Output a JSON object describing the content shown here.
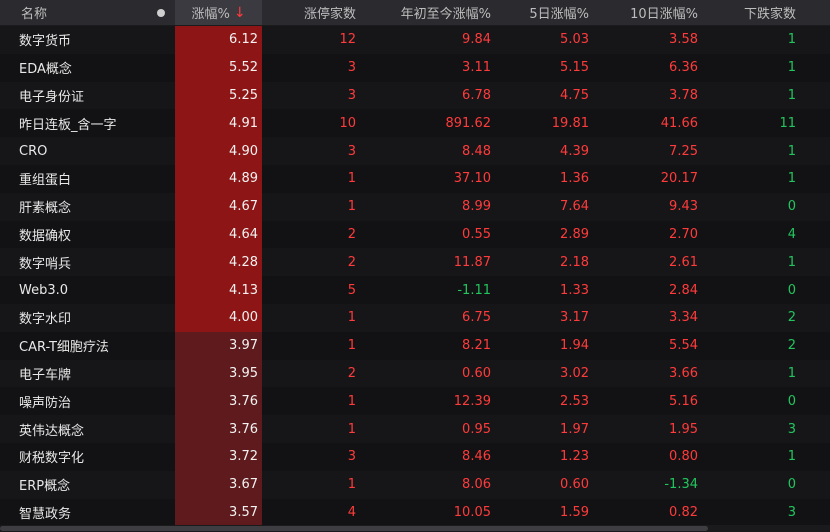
{
  "header": {
    "name": "名称",
    "change": "涨幅%",
    "sort_arrow": "↓",
    "limit_up": "涨停家数",
    "ytd": "年初至今涨幅%",
    "d5": "5日涨幅%",
    "d10": "10日涨幅%",
    "down": "下跌家数"
  },
  "colors": {
    "up": "#ff3b3b",
    "down": "#22c55e",
    "change_bg_strong": "#8e1515",
    "change_bg_weak": "#5e1a1c"
  },
  "rows": [
    {
      "name": "数字货币",
      "chg": "6.12",
      "lim": "12",
      "ytd": "9.84",
      "d5": "5.03",
      "d10": "3.58",
      "down": "1"
    },
    {
      "name": "EDA概念",
      "chg": "5.52",
      "lim": "3",
      "ytd": "3.11",
      "d5": "5.15",
      "d10": "6.36",
      "down": "1"
    },
    {
      "name": "电子身份证",
      "chg": "5.25",
      "lim": "3",
      "ytd": "6.78",
      "d5": "4.75",
      "d10": "3.78",
      "down": "1"
    },
    {
      "name": "昨日连板_含一字",
      "chg": "4.91",
      "lim": "10",
      "ytd": "891.62",
      "d5": "19.81",
      "d10": "41.66",
      "down": "11"
    },
    {
      "name": "CRO",
      "chg": "4.90",
      "lim": "3",
      "ytd": "8.48",
      "d5": "4.39",
      "d10": "7.25",
      "down": "1"
    },
    {
      "name": "重组蛋白",
      "chg": "4.89",
      "lim": "1",
      "ytd": "37.10",
      "d5": "1.36",
      "d10": "20.17",
      "down": "1"
    },
    {
      "name": "肝素概念",
      "chg": "4.67",
      "lim": "1",
      "ytd": "8.99",
      "d5": "7.64",
      "d10": "9.43",
      "down": "0"
    },
    {
      "name": "数据确权",
      "chg": "4.64",
      "lim": "2",
      "ytd": "0.55",
      "d5": "2.89",
      "d10": "2.70",
      "down": "4"
    },
    {
      "name": "数字哨兵",
      "chg": "4.28",
      "lim": "2",
      "ytd": "11.87",
      "d5": "2.18",
      "d10": "2.61",
      "down": "1"
    },
    {
      "name": "Web3.0",
      "chg": "4.13",
      "lim": "5",
      "ytd": "-1.11",
      "d5": "1.33",
      "d10": "2.84",
      "down": "0"
    },
    {
      "name": "数字水印",
      "chg": "4.00",
      "lim": "1",
      "ytd": "6.75",
      "d5": "3.17",
      "d10": "3.34",
      "down": "2"
    },
    {
      "name": "CAR-T细胞疗法",
      "chg": "3.97",
      "lim": "1",
      "ytd": "8.21",
      "d5": "1.94",
      "d10": "5.54",
      "down": "2"
    },
    {
      "name": "电子车牌",
      "chg": "3.95",
      "lim": "2",
      "ytd": "0.60",
      "d5": "3.02",
      "d10": "3.66",
      "down": "1"
    },
    {
      "name": "噪声防治",
      "chg": "3.76",
      "lim": "1",
      "ytd": "12.39",
      "d5": "2.53",
      "d10": "5.16",
      "down": "0"
    },
    {
      "name": "英伟达概念",
      "chg": "3.76",
      "lim": "1",
      "ytd": "0.95",
      "d5": "1.97",
      "d10": "1.95",
      "down": "3"
    },
    {
      "name": "财税数字化",
      "chg": "3.72",
      "lim": "3",
      "ytd": "8.46",
      "d5": "1.23",
      "d10": "0.80",
      "down": "1"
    },
    {
      "name": "ERP概念",
      "chg": "3.67",
      "lim": "1",
      "ytd": "8.06",
      "d5": "0.60",
      "d10": "-1.34",
      "down": "0"
    },
    {
      "name": "智慧政务",
      "chg": "3.57",
      "lim": "4",
      "ytd": "10.05",
      "d5": "1.59",
      "d10": "0.82",
      "down": "3"
    }
  ]
}
